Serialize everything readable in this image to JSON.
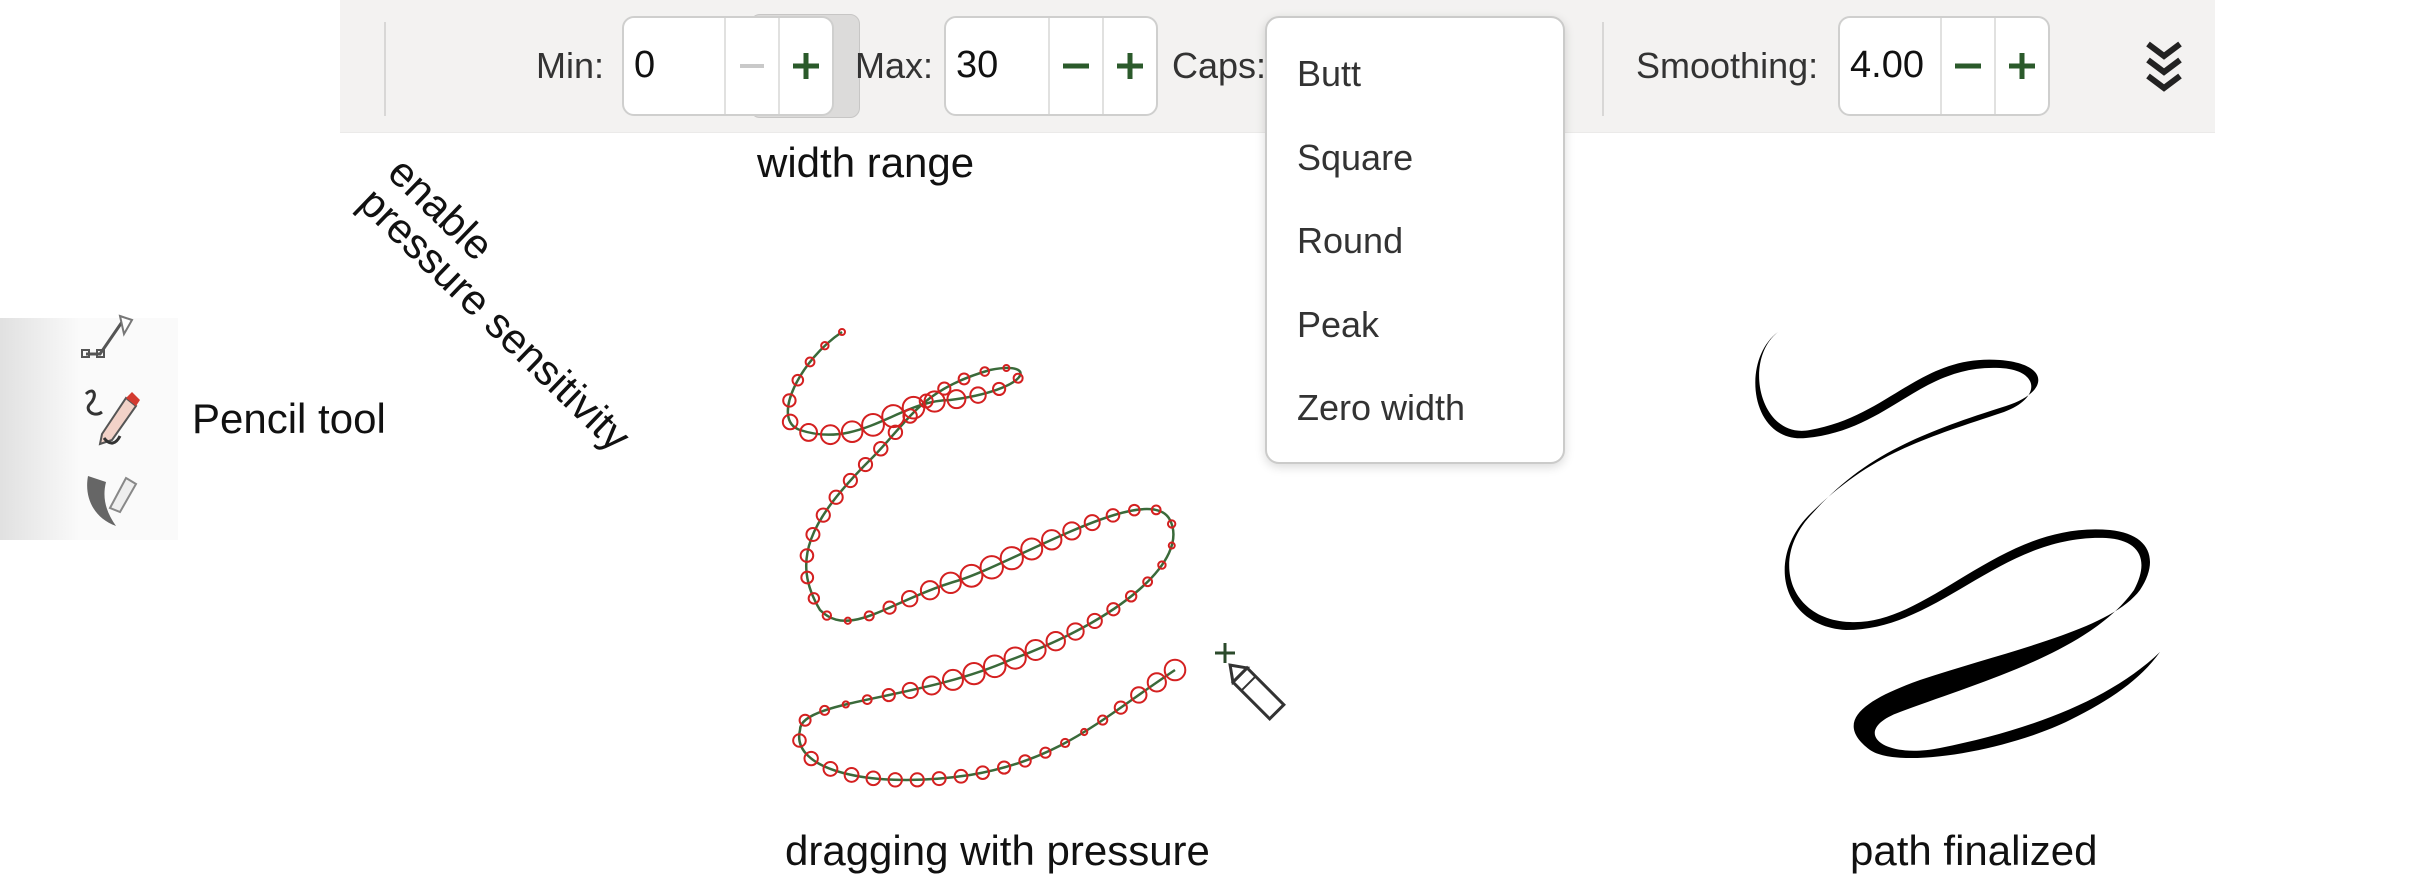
{
  "toolbar": {
    "pressure_button": {
      "icon": "pressure-arrow-down-icon",
      "active": true
    },
    "min": {
      "label": "Min:",
      "value": "0"
    },
    "max": {
      "label": "Max:",
      "value": "30"
    },
    "caps": {
      "label": "Caps:",
      "options": [
        "Butt",
        "Square",
        "Round",
        "Peak",
        "Zero width"
      ]
    },
    "smoothing": {
      "label": "Smoothing:",
      "value": "4.00"
    },
    "more_icon": "double-chevron-down-icon",
    "minus_glyph": "−",
    "plus_glyph": "+"
  },
  "annotations": {
    "enable_pressure": "enable\npressure sensitivity",
    "width_range": "width range",
    "pencil_tool": "Pencil tool",
    "dragging": "dragging with pressure",
    "finalized": "path finalized"
  },
  "tools": [
    "pen-tool-icon",
    "pencil-tool-icon",
    "calligraphy-tool-icon"
  ],
  "colors": {
    "pressure_circles": "#d42020",
    "drag_path": "#3a6a3a",
    "final_stroke": "#000000"
  }
}
